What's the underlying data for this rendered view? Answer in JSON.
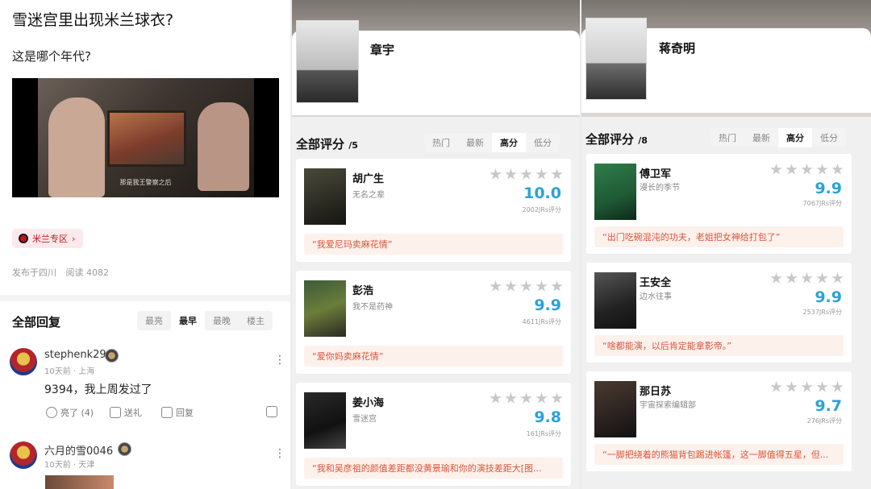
{
  "post": {
    "title": "雪迷宫里出现米兰球衣?",
    "subtitle": "这是哪个年代?",
    "video_caption": "那是我王警察之后",
    "tag": "米兰专区",
    "location": "发布于四川",
    "reads": "阅读 4082"
  },
  "replies": {
    "header": "全部回复",
    "sort_tabs": [
      "最亮",
      "最早",
      "最晚",
      "楼主"
    ],
    "active_tab": "最早",
    "items": [
      {
        "user": "stephenk29",
        "time": "10天前 · 上海",
        "text": "9394，我上周发过了",
        "like": "亮了 (4)",
        "gift": "送礼",
        "reply": "回复"
      },
      {
        "user": "六月的雪0046",
        "time": "10天前 · 天津"
      }
    ]
  },
  "actors": [
    {
      "name": "章宇",
      "count_label": "全部评分",
      "count": "/5",
      "tabs": [
        "热门",
        "最新",
        "高分",
        "低分"
      ],
      "active_tab": "高分",
      "works": [
        {
          "title": "胡广生",
          "role": "无名之辈",
          "score": "10.0",
          "votes": "2002JRs评分",
          "quote": "“我爱尼玛卖麻花情”"
        },
        {
          "title": "彭浩",
          "role": "我不是药神",
          "score": "9.9",
          "votes": "4611JRs评分",
          "quote": "“爱你妈卖麻花情”"
        },
        {
          "title": "姜小海",
          "role": "雪迷宫",
          "score": "9.8",
          "votes": "161JRs评分",
          "quote": "“我和吴彦祖的颜值差距都没黄景瑜和你的演技差距大[图..."
        }
      ]
    },
    {
      "name": "蒋奇明",
      "count_label": "全部评分",
      "count": "/8",
      "tabs": [
        "热门",
        "最新",
        "高分",
        "低分"
      ],
      "active_tab": "高分",
      "works": [
        {
          "title": "傅卫军",
          "role": "漫长的季节",
          "score": "9.9",
          "votes": "7067JRs评分",
          "quote": "“出门吃碗混沌的功夫，老姐把女神给打包了”"
        },
        {
          "title": "王安全",
          "role": "边水往事",
          "score": "9.9",
          "votes": "2537JRs评分",
          "quote": "“啥都能演，以后肯定能拿影帝。”"
        },
        {
          "title": "那日苏",
          "role": "宇宙探索编辑部",
          "score": "9.7",
          "votes": "276JRs评分",
          "quote": "“一脚把绕着的熊猫背包踢进帐篷，这一脚值得五星，但..."
        }
      ]
    }
  ],
  "colors": {
    "score": "#2aa3d8",
    "quote_text": "#d9543a",
    "quote_bg": "#fdf1ec",
    "milan_red": "#c4141e"
  }
}
